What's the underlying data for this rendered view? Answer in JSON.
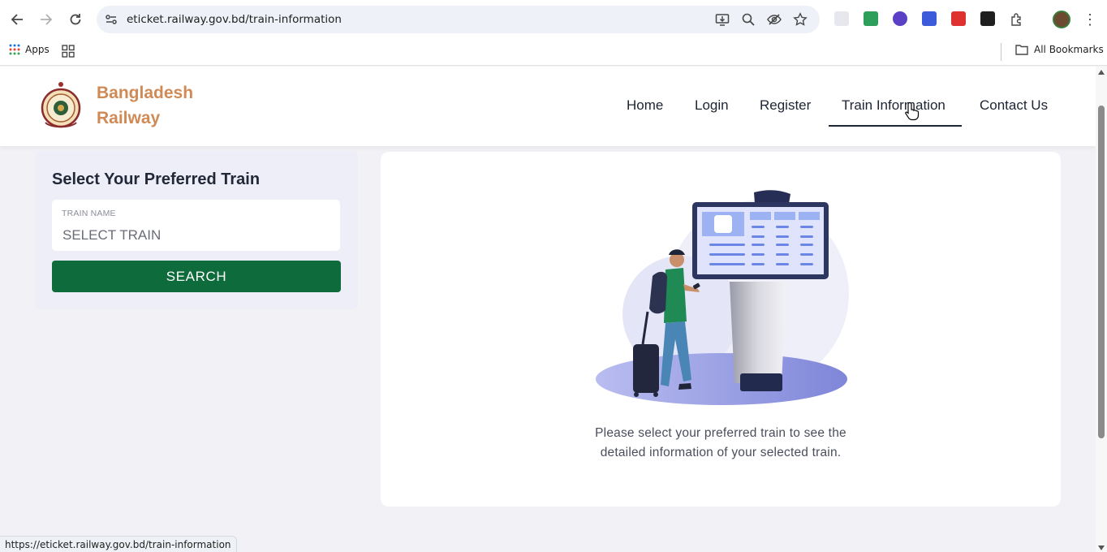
{
  "browser": {
    "url": "eticket.railway.gov.bd/train-information",
    "status_url": "https://eticket.railway.gov.bd/train-information",
    "bookmarks": {
      "apps_label": "Apps",
      "all_bookmarks_label": "All Bookmarks"
    },
    "icons": [
      "back-icon",
      "forward-icon",
      "reload-icon",
      "site-info-icon",
      "install-icon",
      "zoom-icon",
      "eye-off-icon",
      "star-icon",
      "extensions-icon",
      "menu-icon"
    ]
  },
  "site": {
    "brand_line1": "Bangladesh",
    "brand_line2": "Railway",
    "brand_color": "#d08a55",
    "nav": [
      {
        "label": "Home"
      },
      {
        "label": "Login"
      },
      {
        "label": "Register"
      },
      {
        "label": "Train Information",
        "active": true
      },
      {
        "label": "Contact Us"
      }
    ]
  },
  "search_panel": {
    "title": "Select Your Preferred Train",
    "field_label": "TRAIN NAME",
    "field_value": "SELECT TRAIN",
    "button_label": "SEARCH",
    "button_color": "#0d6b3c"
  },
  "info_card": {
    "line1": "Please select your preferred train to see the",
    "line2": "detailed information of your selected train."
  }
}
